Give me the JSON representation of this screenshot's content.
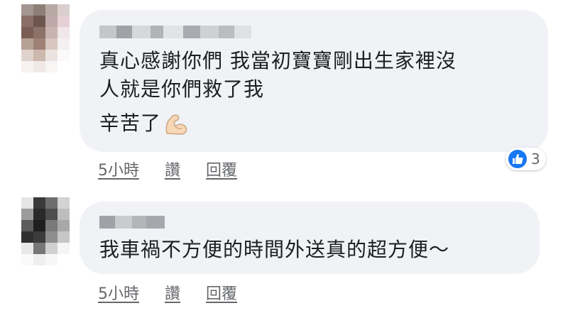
{
  "comments": [
    {
      "text_lines": [
        "真心感謝你們 我當初寶寶剛出生家裡沒",
        "人就是你們救了我",
        "辛苦了"
      ],
      "emoji": "flexed-biceps-emoji",
      "time": "5小時",
      "like_label": "讚",
      "reply_label": "回覆",
      "reaction_count": "3"
    },
    {
      "text_lines": [
        "我車禍不方便的時間外送真的超方便～"
      ],
      "time": "5小時",
      "like_label": "讚",
      "reply_label": "回覆"
    }
  ],
  "colors": {
    "bubble": "#f0f2f5",
    "like_blue": "#1877f2",
    "meta_text": "#65676b"
  }
}
